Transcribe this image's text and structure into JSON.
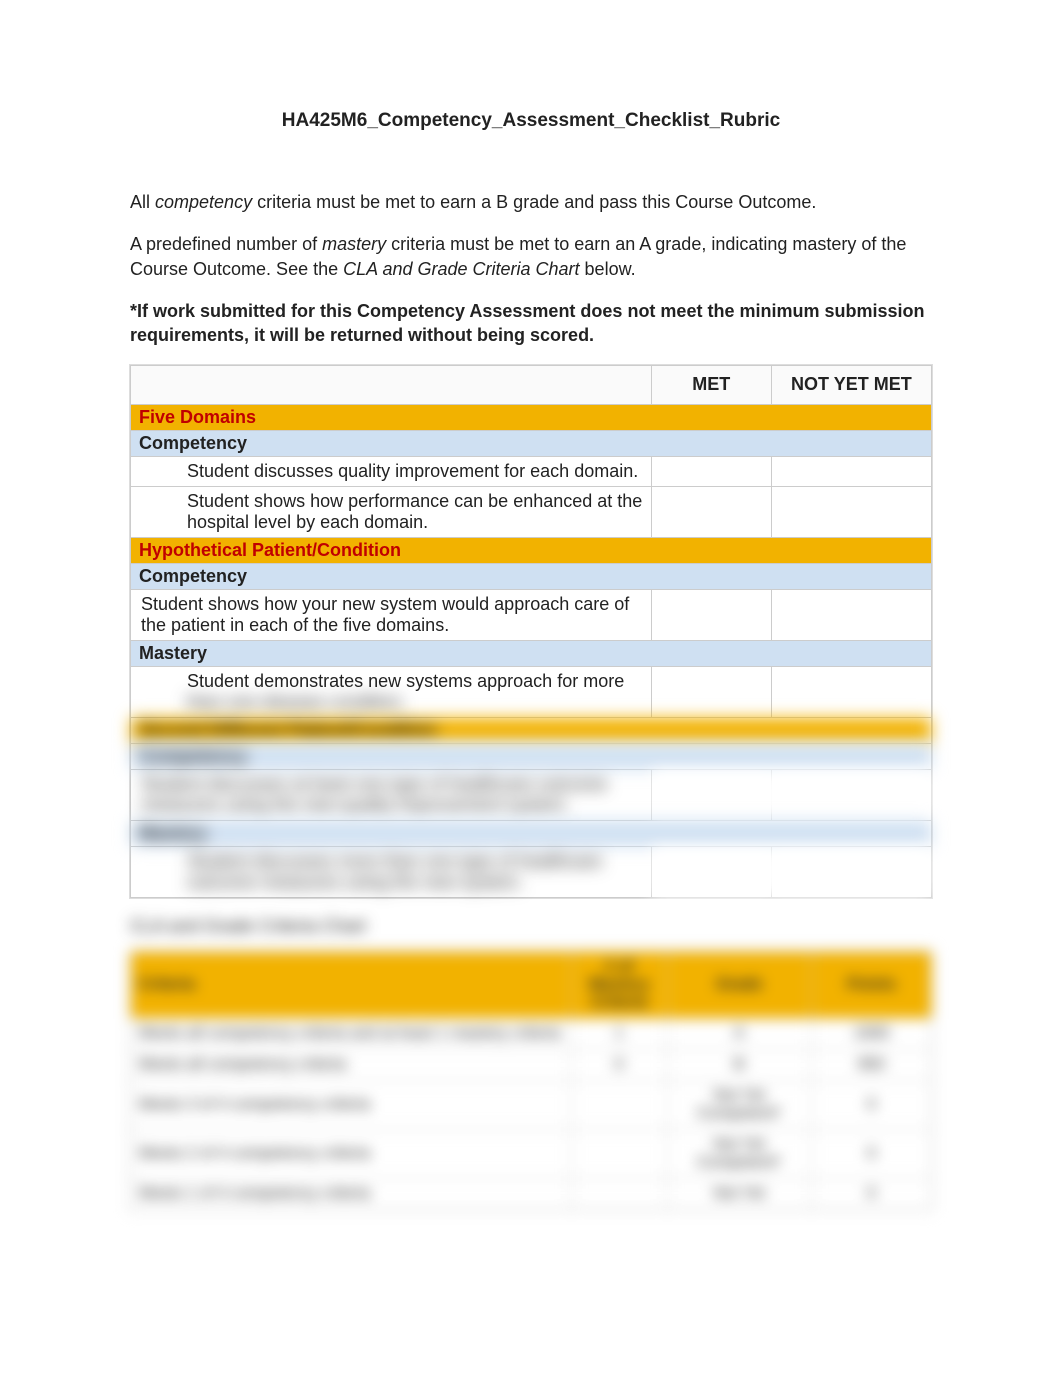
{
  "title": "HA425M6_Competency_Assessment_Checklist_Rubric",
  "intro": {
    "p1_a": "All ",
    "p1_em": "competency",
    "p1_b": " criteria must be met to earn a B grade and pass this Course Outcome.",
    "p2_a": "A predefined number of ",
    "p2_em": "mastery",
    "p2_b": " criteria must be met to earn an A grade, indicating mastery of the Course Outcome. See the ",
    "p2_em2": "CLA and Grade Criteria Chart",
    "p2_c": " below.",
    "note": "*If work submitted for this Competency Assessment does not meet the minimum submission requirements, it will be returned without being scored."
  },
  "rubric": {
    "headers": {
      "criteria": "",
      "met": "MET",
      "notmet": "NOT YET MET"
    },
    "sections": [
      {
        "title": "Five Domains",
        "title_color": "red",
        "bands": [
          {
            "label": "Competency",
            "rows": [
              {
                "text": "Student discusses quality improvement for each domain.",
                "indent": true
              },
              {
                "text": "Student shows how performance can be enhanced at the hospital level by each domain.",
                "indent": true
              }
            ]
          }
        ]
      },
      {
        "title": "Hypothetical Patient/Condition",
        "title_color": "red",
        "bands": [
          {
            "label": "Competency",
            "rows": [
              {
                "text": "Student shows how your new system would approach care of the patient in each of the five domains.",
                "indent": false
              }
            ]
          },
          {
            "label": "Mastery",
            "rows": [
              {
                "text": "Student demonstrates new systems approach for more than one disease condition.",
                "indent": true,
                "blur_second_line": true
              }
            ]
          }
        ]
      },
      {
        "title": "Second Different Patient/Condition",
        "title_color": "black",
        "blurred": true,
        "bands": [
          {
            "label": "Competency",
            "rows": [
              {
                "text": "Student discusses at least one type of healthcare outcome measures using the new quality improvement system.",
                "indent": false
              }
            ]
          },
          {
            "label": "Mastery",
            "rows": [
              {
                "text": "Student discusses more than one type of healthcare outcome measures using the new system.",
                "indent": true
              }
            ]
          }
        ]
      }
    ]
  },
  "chart_caption": "CLA and Grade Criteria Chart",
  "gradechart": {
    "headers": {
      "criteria": "Criteria",
      "mastery": "# of Mastery Criteria",
      "grade": "Grade",
      "points": "Points"
    },
    "rows": [
      {
        "c": "Meets all competency criteria and at least 1 mastery criteria",
        "m": "1",
        "g": "A",
        "p": "1000"
      },
      {
        "c": "Meets all competency criteria",
        "m": "0",
        "g": "B",
        "p": "850"
      },
      {
        "c": "Meets 3 of 4 competency criteria",
        "m": "",
        "g": "Not Yet Competent*",
        "p": "0"
      },
      {
        "c": "Meets 2 of 4 competency criteria",
        "m": "",
        "g": "Not Yet Competent*",
        "p": "0"
      },
      {
        "c": "Meets 1 of 4 competency criteria",
        "m": "",
        "g": "Not Yet",
        "p": "0"
      }
    ]
  }
}
